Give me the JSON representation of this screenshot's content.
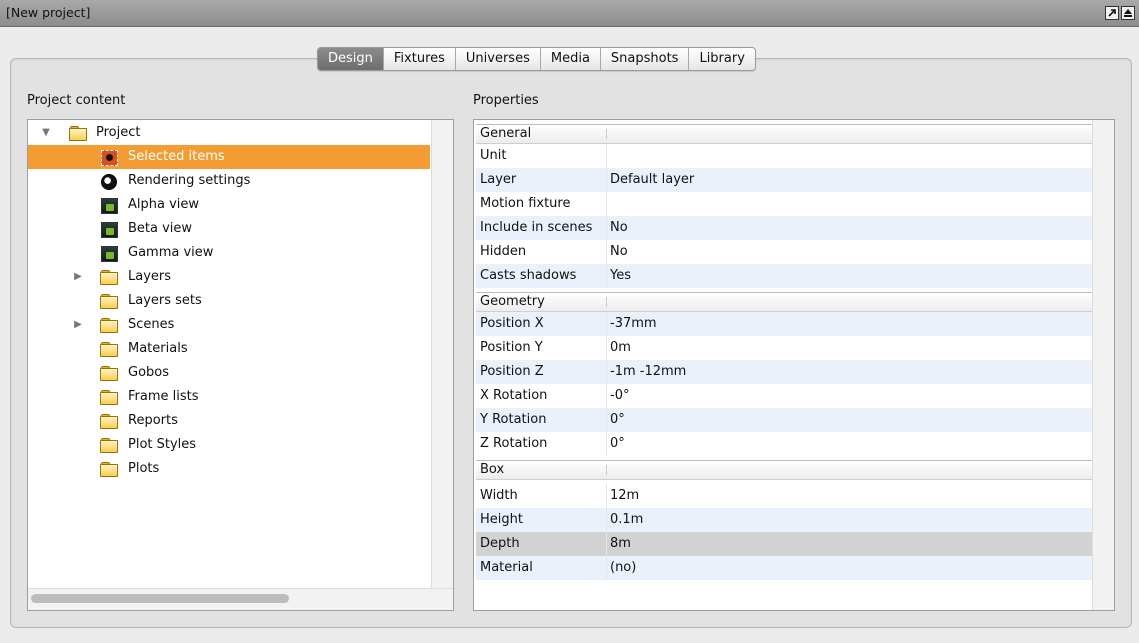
{
  "window": {
    "title": "[New project]"
  },
  "tabs": [
    {
      "label": "Design",
      "active": true
    },
    {
      "label": "Fixtures",
      "active": false
    },
    {
      "label": "Universes",
      "active": false
    },
    {
      "label": "Media",
      "active": false
    },
    {
      "label": "Snapshots",
      "active": false
    },
    {
      "label": "Library",
      "active": false
    }
  ],
  "project_content": {
    "label": "Project content",
    "items": [
      {
        "label": "Project",
        "icon": "folder-icon",
        "expanded": true
      },
      {
        "label": "Selected items",
        "icon": "selection-icon",
        "selected": true
      },
      {
        "label": "Rendering settings",
        "icon": "rendering-icon"
      },
      {
        "label": "Alpha view",
        "icon": "view-icon"
      },
      {
        "label": "Beta view",
        "icon": "view-icon"
      },
      {
        "label": "Gamma view",
        "icon": "view-icon"
      },
      {
        "label": "Layers",
        "icon": "folder-icon",
        "expandable": true
      },
      {
        "label": "Layers sets",
        "icon": "folder-icon"
      },
      {
        "label": "Scenes",
        "icon": "folder-icon",
        "expandable": true
      },
      {
        "label": "Materials",
        "icon": "folder-icon"
      },
      {
        "label": "Gobos",
        "icon": "folder-icon"
      },
      {
        "label": "Frame lists",
        "icon": "folder-icon"
      },
      {
        "label": "Reports",
        "icon": "folder-icon"
      },
      {
        "label": "Plot Styles",
        "icon": "folder-icon"
      },
      {
        "label": "Plots",
        "icon": "folder-icon"
      }
    ]
  },
  "properties": {
    "label": "Properties",
    "groups": [
      {
        "name": "General",
        "rows": [
          {
            "name": "Unit",
            "value": ""
          },
          {
            "name": "Layer",
            "value": "Default layer"
          },
          {
            "name": "Motion fixture",
            "value": ""
          },
          {
            "name": "Include in scenes",
            "value": "No"
          },
          {
            "name": "Hidden",
            "value": "No"
          },
          {
            "name": "Casts shadows",
            "value": "Yes"
          }
        ]
      },
      {
        "name": "Geometry",
        "rows": [
          {
            "name": "Position X",
            "value": "-37mm"
          },
          {
            "name": "Position Y",
            "value": "0m"
          },
          {
            "name": "Position Z",
            "value": "-1m -12mm"
          },
          {
            "name": "X Rotation",
            "value": "-0°"
          },
          {
            "name": "Y Rotation",
            "value": "0°"
          },
          {
            "name": "Z Rotation",
            "value": "0°"
          }
        ]
      },
      {
        "name": "Box",
        "rows": [
          {
            "name": "Width",
            "value": "12m"
          },
          {
            "name": "Height",
            "value": "0.1m"
          },
          {
            "name": "Depth",
            "value": "8m",
            "selected": true
          },
          {
            "name": "Material",
            "value": "(no)"
          }
        ]
      }
    ]
  }
}
